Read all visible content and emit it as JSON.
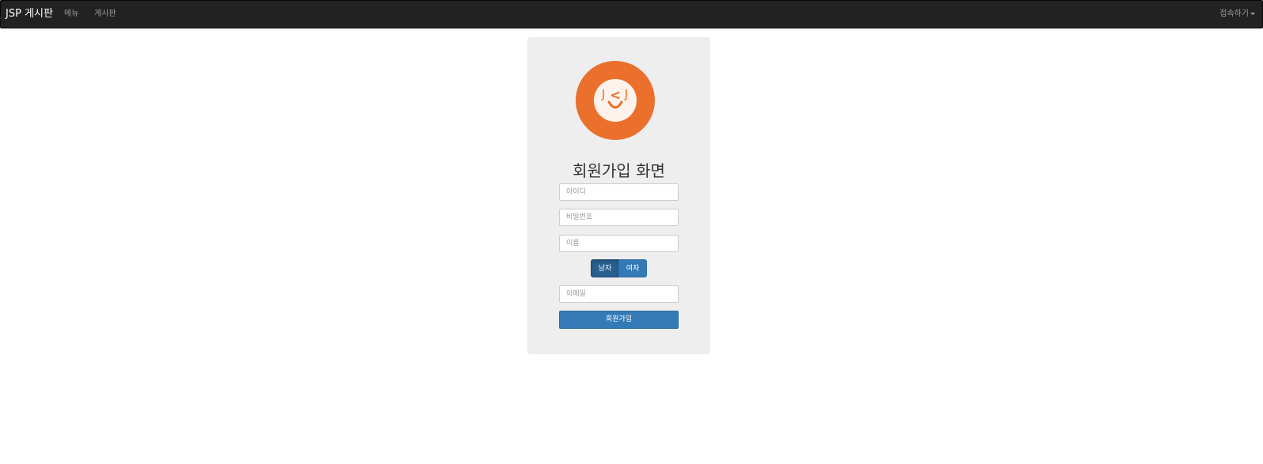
{
  "navbar": {
    "brand": "JSP 게시판",
    "menu": "메뉴",
    "board": "게시판",
    "connect": "접속하기"
  },
  "form": {
    "title": "회원가입 화면",
    "id_placeholder": "아이디",
    "password_placeholder": "비밀번호",
    "name_placeholder": "이름",
    "gender_male": "남자",
    "gender_female": "여자",
    "gender_selected": "남자",
    "email_placeholder": "이메일",
    "submit": "회원가입"
  },
  "logo": {
    "icon": "smiley-face-logo",
    "text_left": "J",
    "text_mid": "<",
    "text_right": "J"
  },
  "colors": {
    "navbar_bg": "#222222",
    "logo_orange": "#eb702b",
    "primary_button": "#337ab7",
    "active_button": "#286090",
    "card_bg": "#eeeeee"
  }
}
